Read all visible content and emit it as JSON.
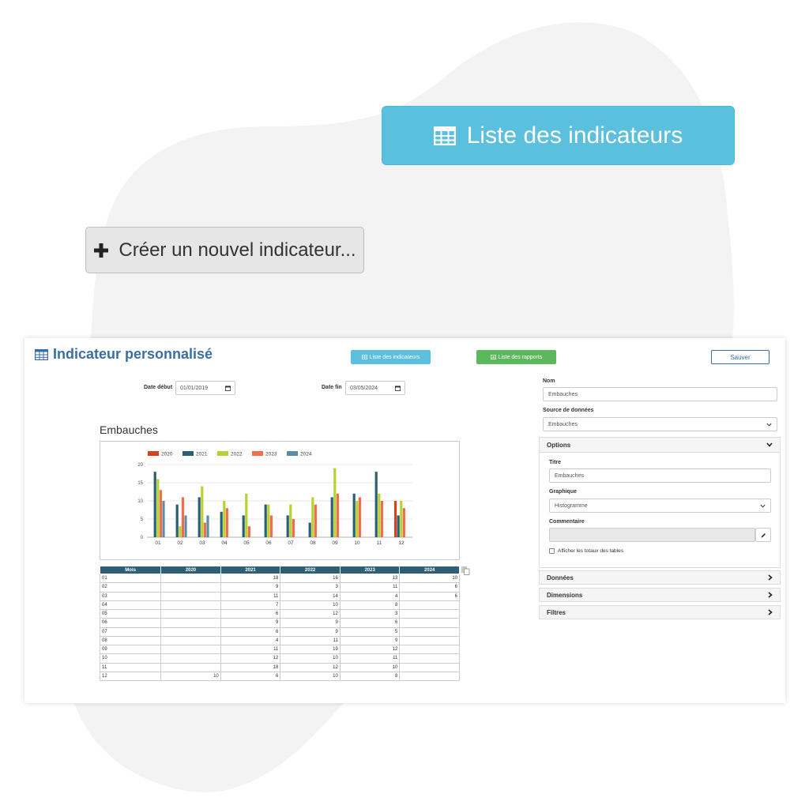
{
  "hero": {
    "list_button": "Liste des indicateurs",
    "create_button": "Créer un nouvel indicateur..."
  },
  "header": {
    "title": "Indicateur personnalisé",
    "btn_indicators": "Liste des indicateurs",
    "btn_reports": "Liste des rapports",
    "btn_save": "Sauver"
  },
  "filters": {
    "start_label": "Date début",
    "start_value": "01/01/2019",
    "end_label": "Date fin",
    "end_value": "03/05/2024"
  },
  "chart_data": {
    "type": "bar",
    "title": "Embauches",
    "categories": [
      "01",
      "02",
      "03",
      "04",
      "05",
      "06",
      "07",
      "08",
      "09",
      "10",
      "11",
      "12"
    ],
    "ylim": [
      0,
      20
    ],
    "yticks": [
      0,
      5,
      10,
      15,
      20
    ],
    "grid": true,
    "legend": "top",
    "series": [
      {
        "name": "2020",
        "color": "#d9411e",
        "values": [
          0,
          0,
          0,
          0,
          0,
          0,
          0,
          0,
          0,
          0,
          0,
          10
        ]
      },
      {
        "name": "2021",
        "color": "#2c5f73",
        "values": [
          18,
          9,
          11,
          7,
          6,
          9,
          6,
          4,
          11,
          12,
          18,
          6
        ]
      },
      {
        "name": "2022",
        "color": "#b5d334",
        "values": [
          16,
          3,
          14,
          10,
          12,
          9,
          9,
          11,
          19,
          10,
          12,
          10
        ]
      },
      {
        "name": "2023",
        "color": "#f26c4f",
        "values": [
          13,
          11,
          4,
          8,
          3,
          6,
          5,
          9,
          12,
          11,
          10,
          8
        ]
      },
      {
        "name": "2024",
        "color": "#5b8fa8",
        "values": [
          10,
          6,
          6,
          0,
          0,
          0,
          0,
          0,
          0,
          0,
          0,
          0
        ]
      }
    ]
  },
  "table": {
    "headers": [
      "Mois",
      "2020",
      "2021",
      "2022",
      "2023",
      "2024"
    ],
    "rows": [
      [
        "01",
        "",
        "18",
        "16",
        "13",
        "10"
      ],
      [
        "02",
        "",
        "9",
        "3",
        "11",
        "6"
      ],
      [
        "03",
        "",
        "11",
        "14",
        "4",
        "6"
      ],
      [
        "04",
        "",
        "7",
        "10",
        "8",
        ""
      ],
      [
        "05",
        "",
        "6",
        "12",
        "3",
        ""
      ],
      [
        "06",
        "",
        "9",
        "9",
        "6",
        ""
      ],
      [
        "07",
        "",
        "6",
        "9",
        "5",
        ""
      ],
      [
        "08",
        "",
        "4",
        "11",
        "9",
        ""
      ],
      [
        "09",
        "",
        "11",
        "19",
        "12",
        ""
      ],
      [
        "10",
        "",
        "12",
        "10",
        "11",
        ""
      ],
      [
        "11",
        "",
        "18",
        "12",
        "10",
        ""
      ],
      [
        "12",
        "10",
        "6",
        "10",
        "8",
        ""
      ]
    ]
  },
  "form": {
    "name_label": "Nom",
    "name_value": "Embauches",
    "source_label": "Source de données",
    "source_value": "Embauches",
    "options_label": "Options",
    "title_label": "Titre",
    "title_value": "Embauches",
    "graph_label": "Graphique",
    "graph_value": "Histogramme",
    "comment_label": "Commentaire",
    "totals_label": "Afficher les totaux des tables",
    "data_label": "Données",
    "dimensions_label": "Dimensions",
    "filters_label": "Filtres"
  },
  "colors": {
    "info": "#5bc0de",
    "success": "#5cb85c",
    "title": "#3a6ea5",
    "table_header": "#2f5f77"
  }
}
